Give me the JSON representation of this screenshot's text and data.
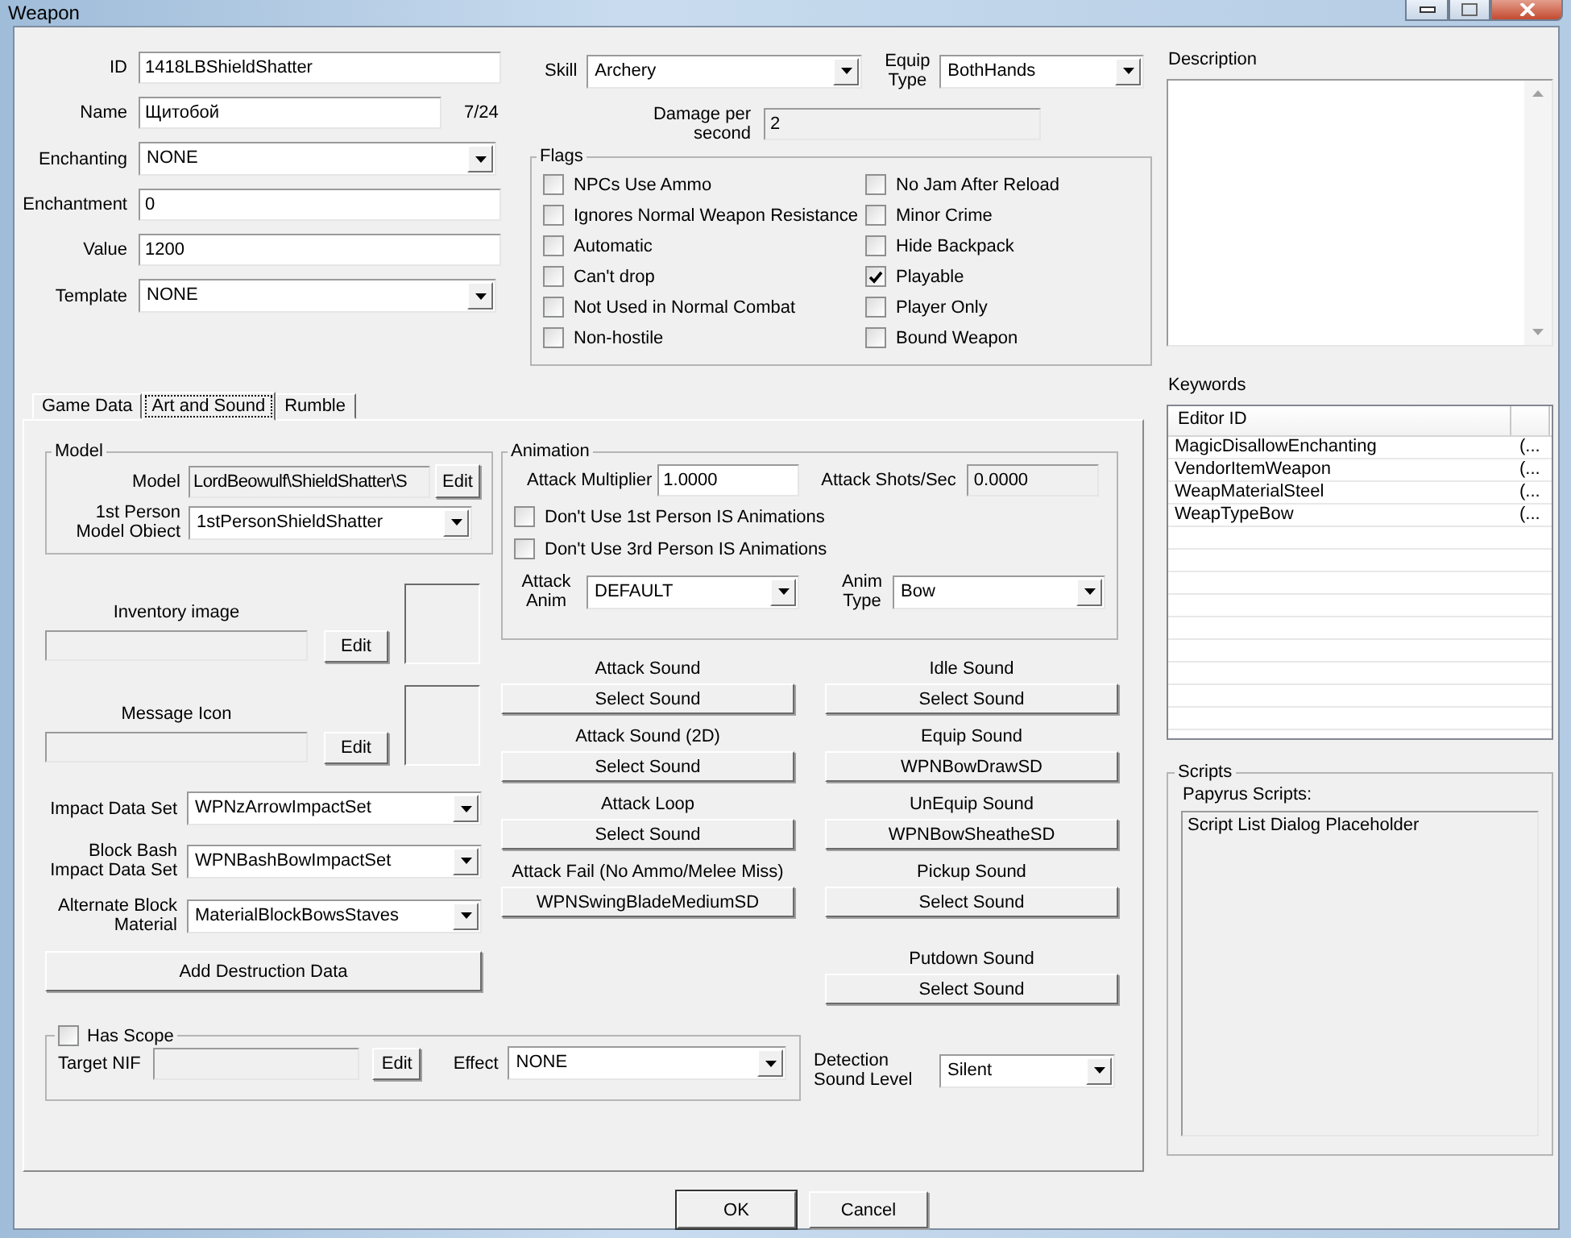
{
  "window": {
    "title": "Weapon"
  },
  "fields": [
    {
      "label": "ID",
      "kind": "text",
      "value": "1418LBShieldShatter"
    },
    {
      "label": "Name",
      "kind": "text",
      "value": "Щитобой",
      "counter": "7/24"
    },
    {
      "label": "Enchanting",
      "kind": "select",
      "value": "NONE"
    },
    {
      "label": "Enchantment",
      "kind": "text",
      "value": "0"
    },
    {
      "label": "Value",
      "kind": "text",
      "value": "1200"
    },
    {
      "label": "Template",
      "kind": "select",
      "value": "NONE"
    }
  ],
  "skill": {
    "label": "Skill",
    "value": "Archery"
  },
  "equip_type": {
    "label": "Equip Type",
    "value": "BothHands"
  },
  "damage_per_second": {
    "label": "Damage per second",
    "value": "2"
  },
  "flags": {
    "title": "Flags",
    "left": [
      {
        "label": "NPCs Use Ammo",
        "checked": false
      },
      {
        "label": "Ignores Normal Weapon Resistance",
        "checked": false
      },
      {
        "label": "Automatic",
        "checked": false
      },
      {
        "label": "Can't drop",
        "checked": false
      },
      {
        "label": "Not Used in Normal Combat",
        "checked": false
      },
      {
        "label": "Non-hostile",
        "checked": false
      }
    ],
    "right": [
      {
        "label": "No Jam After Reload",
        "checked": false
      },
      {
        "label": "Minor Crime",
        "checked": false
      },
      {
        "label": "Hide Backpack",
        "checked": false
      },
      {
        "label": "Playable",
        "checked": true
      },
      {
        "label": "Player Only",
        "checked": false
      },
      {
        "label": "Bound Weapon",
        "checked": false
      }
    ]
  },
  "description": {
    "label": "Description"
  },
  "keywords": {
    "label": "Keywords",
    "columns": [
      "Editor ID"
    ],
    "rows": [
      {
        "editor_id": "MagicDisallowEnchanting",
        "column_2": "(..."
      },
      {
        "editor_id": "VendorItemWeapon",
        "column_2": "(..."
      },
      {
        "editor_id": "WeapMaterialSteel",
        "column_2": "(..."
      },
      {
        "editor_id": "WeapTypeBow",
        "column_2": "(..."
      }
    ]
  },
  "scripts": {
    "title": "Scripts",
    "label": "Papyrus Scripts:",
    "items": [
      "Script List Dialog Placeholder"
    ]
  },
  "tabs": [
    {
      "label": "Game Data",
      "selected": false
    },
    {
      "label": "Art and Sound",
      "selected": true
    },
    {
      "label": "Rumble",
      "selected": false
    }
  ],
  "model": {
    "title": "Model",
    "model_label": "Model",
    "model_value": "LordBeowulf\\ShieldShatter\\S",
    "edit": "Edit",
    "first_person_label": "1st Person Model Obiect",
    "first_person_value": "1stPersonShieldShatter"
  },
  "images": [
    {
      "label": "Inventory image",
      "button": "Edit"
    },
    {
      "label": "Message Icon",
      "button": "Edit"
    }
  ],
  "data_sets": [
    {
      "label": "Impact Data Set",
      "value": "WPNzArrowImpactSet"
    },
    {
      "label": "Block Bash Impact Data Set",
      "value": "WPNBashBowImpactSet"
    },
    {
      "label": "Alternate Block Material",
      "value": "MaterialBlockBowsStaves"
    }
  ],
  "destruction_button": "Add Destruction Data",
  "animation": {
    "title": "Animation",
    "attack_multiplier": {
      "label": "Attack Multiplier",
      "value": "1.0000"
    },
    "attack_shots": {
      "label": "Attack Shots/Sec",
      "value": "0.0000"
    },
    "options": [
      {
        "label": "Don't Use 1st Person IS Animations",
        "checked": false
      },
      {
        "label": "Don't Use 3rd Person IS Animations",
        "checked": false
      }
    ],
    "attack_anim": {
      "label": "Attack Anim",
      "value": "DEFAULT"
    },
    "anim_type": {
      "label": "Anim Type",
      "value": "Bow"
    }
  },
  "sounds_left": [
    {
      "label": "Attack Sound",
      "button": "Select Sound"
    },
    {
      "label": "Attack Sound  (2D)",
      "button": "Select Sound"
    },
    {
      "label": "Attack Loop",
      "button": "Select Sound"
    },
    {
      "label": "Attack Fail (No Ammo/Melee Miss)",
      "button": "WPNSwingBladeMediumSD"
    }
  ],
  "sounds_right": [
    {
      "label": "Idle Sound",
      "button": "Select Sound"
    },
    {
      "label": "Equip Sound",
      "button": "WPNBowDrawSD"
    },
    {
      "label": "UnEquip Sound",
      "button": "WPNBowSheatheSD"
    },
    {
      "label": "Pickup Sound",
      "button": "Select Sound"
    },
    {
      "label": "Putdown Sound",
      "button": "Select Sound"
    }
  ],
  "scope": {
    "label": "Has Scope",
    "checked": false,
    "target_label": "Target NIF",
    "edit": "Edit",
    "effect_label": "Effect",
    "effect_value": "NONE"
  },
  "detection": {
    "label": "Detection Sound Level",
    "value": "Silent"
  },
  "buttons": [
    "OK",
    "Cancel"
  ]
}
